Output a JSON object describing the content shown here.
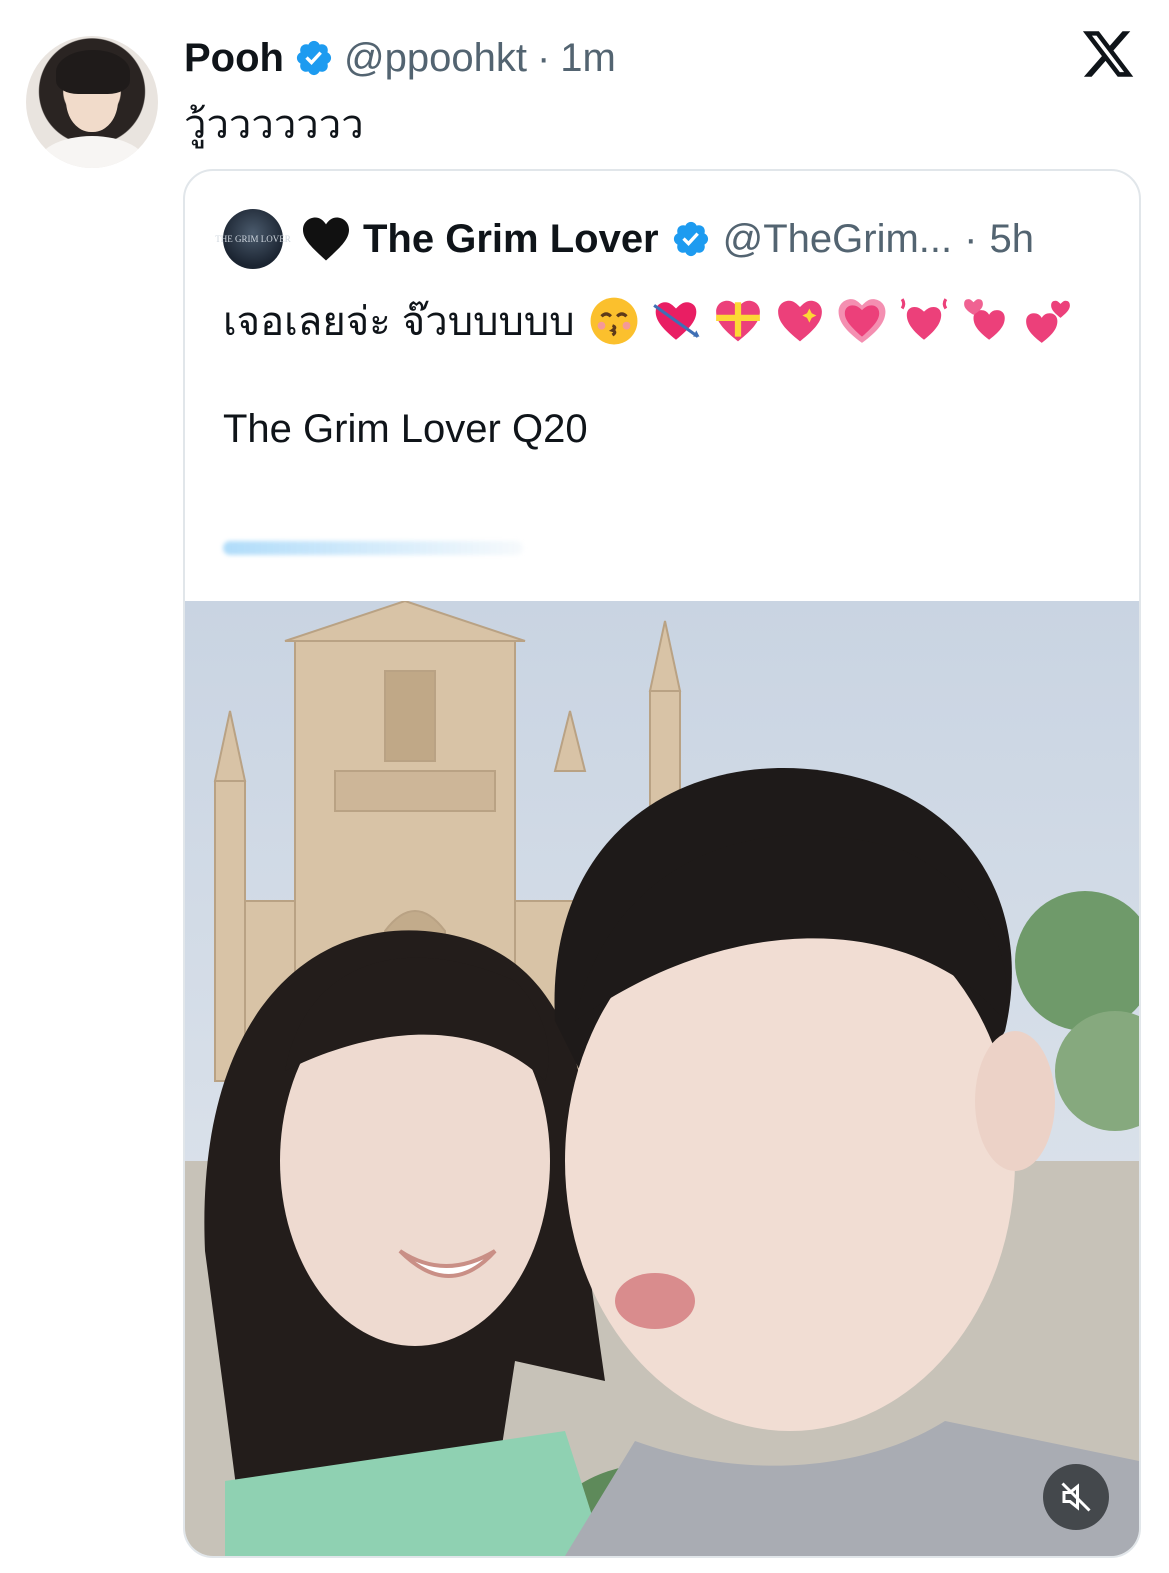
{
  "tweet": {
    "author_name": "Pooh",
    "handle": "@ppoohkt",
    "separator": "·",
    "time": "1m",
    "text": "วู้ววววววว"
  },
  "quote": {
    "author_name": "The Grim Lover",
    "handle": "@TheGrim...",
    "separator": "·",
    "time": "5h",
    "avatar_text": "THE GRIM LOVER",
    "text": "เจอเลยจ่ะ จ๊วบบบบบ",
    "emojis": [
      "kissing-face-with-closed-eyes",
      "heart-with-arrow",
      "heart-with-ribbon",
      "sparkling-heart",
      "growing-heart",
      "beating-heart",
      "revolving-hearts",
      "two-hearts"
    ],
    "subtitle": "The Grim Lover Q20"
  },
  "colors": {
    "verified": "#1d9bf0",
    "muted": "#536471",
    "border": "#e1e6ea",
    "pink": "#f04e98"
  }
}
